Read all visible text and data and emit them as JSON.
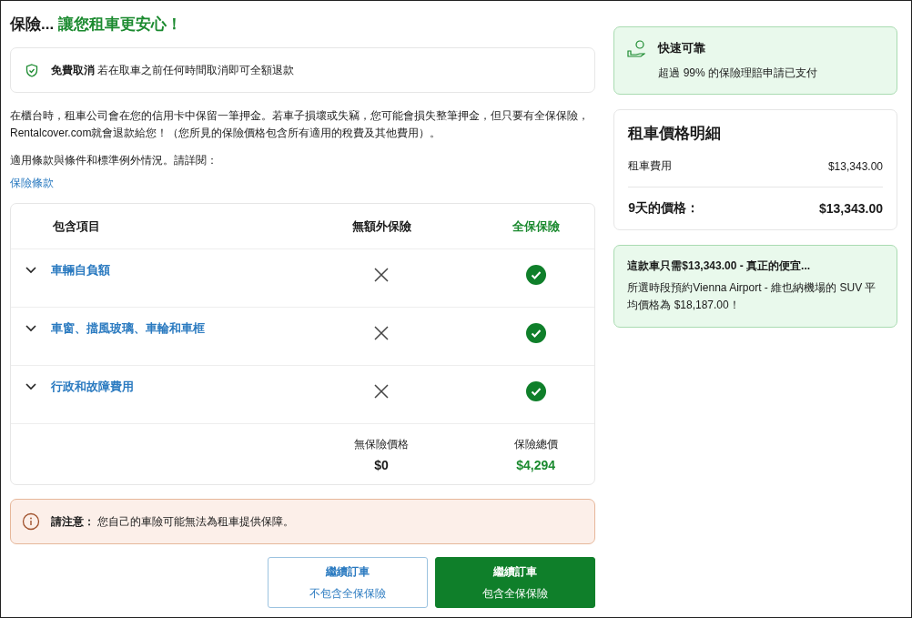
{
  "heading": {
    "lead": "保險...",
    "highlight": "讓您租車更安心！"
  },
  "free_cancel": {
    "label": "免費取消",
    "text": "若在取車之前任何時間取消即可全額退款"
  },
  "description": "在櫃台時，租車公司會在您的信用卡中保留一筆押金。若車子損壞或失竊，您可能會損失整筆押金，但只要有全保保險，Rentalcover.com就會退款給您！（您所見的保險價格包含所有適用的稅費及其他費用）。",
  "terms_text": "適用條款與條件和標準例外情況。請詳閱：",
  "terms_link": "保險條款",
  "table": {
    "columns": [
      "包含項目",
      "無額外保險",
      "全保保險"
    ],
    "rows": [
      {
        "label": "車輛自負額",
        "expanded": false,
        "basic_covered": false,
        "full_covered": true
      },
      {
        "label": "車窗、擋風玻璃、車輪和車框",
        "expanded": false,
        "basic_covered": false,
        "full_covered": true
      },
      {
        "label": "行政和故障費用",
        "expanded": false,
        "basic_covered": false,
        "full_covered": true
      }
    ],
    "totals": [
      {
        "label": "無保險價格",
        "value": "$0"
      },
      {
        "label": "保險總價",
        "value": "$4,294"
      }
    ]
  },
  "notice": {
    "label": "請注意：",
    "text": "您自己的車險可能無法為租車提供保障。"
  },
  "buttons": [
    {
      "kind": "outline",
      "title": "繼續訂車",
      "subtitle": "不包含全保保險"
    },
    {
      "kind": "primary",
      "title": "繼續訂車",
      "subtitle": "包含全保保險"
    }
  ],
  "reliable": {
    "title": "快速可靠",
    "text": "超過 99% 的保險理賠申請已支付"
  },
  "price": {
    "title": "租車價格明細",
    "rows": [
      {
        "label": "租車費用",
        "value": "$13,343.00",
        "kind": "item"
      },
      {
        "label": "9天的價格：",
        "value": "$13,343.00",
        "kind": "total"
      }
    ]
  },
  "deal": {
    "title": "這款車只需$13,343.00 - 真正的便宜...",
    "text": "所選時段預約Vienna Airport - 維也納機場的 SUV 平均價格為 $18,187.00！"
  }
}
